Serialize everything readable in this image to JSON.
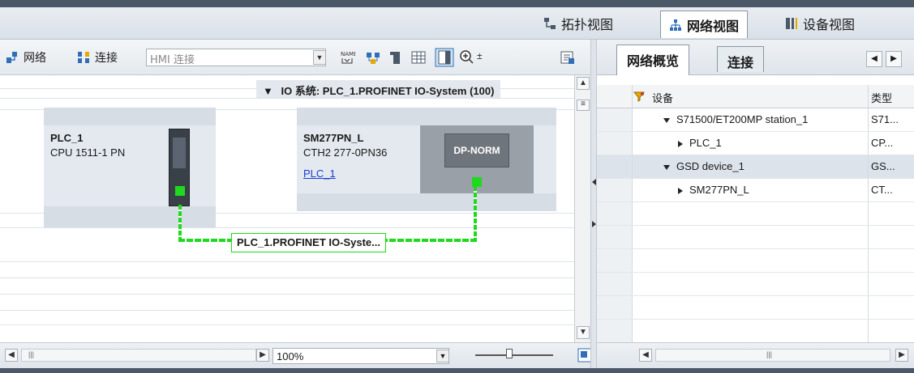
{
  "view_tabs": [
    {
      "label": "拓扑视图",
      "icon": "topology-icon"
    },
    {
      "label": "网络视图",
      "icon": "network-icon",
      "active": true
    },
    {
      "label": "设备视图",
      "icon": "device-icon"
    }
  ],
  "toolbar": {
    "network_label": "网络",
    "connections_label": "连接",
    "connection_type_value": "HMI 连接",
    "icons": [
      "name-icon",
      "network-tool-icon",
      "module-icon",
      "table-icon",
      "panel-icon",
      "zoom-in-icon",
      "export-icon"
    ]
  },
  "canvas": {
    "io_system_label": "IO 系统: PLC_1.PROFINET IO-System (100)",
    "network_line_label": "PLC_1.PROFINET IO-Syste...",
    "devices": [
      {
        "name": "PLC_1",
        "type": "CPU 1511-1 PN"
      },
      {
        "name": "SM277PN_L",
        "type": "CTH2 277-0PN36",
        "link": "PLC_1",
        "module_label": "DP-NORM"
      }
    ]
  },
  "statusbar": {
    "zoom_value": "100%"
  },
  "overview": {
    "tabs": [
      "网络概览",
      "连接"
    ],
    "columns": {
      "device": "设备",
      "type": "类型"
    },
    "rows": [
      {
        "device": "S71500/ET200MP station_1",
        "type": "S71...",
        "expanded": true,
        "indent": 0
      },
      {
        "device": "PLC_1",
        "type": "CP...",
        "expanded": false,
        "indent": 1
      },
      {
        "device": "GSD device_1",
        "type": "GS...",
        "expanded": true,
        "indent": 0
      },
      {
        "device": "SM277PN_L",
        "type": "CT...",
        "expanded": false,
        "indent": 1
      }
    ]
  },
  "colors": {
    "accent_green": "#1fd91f",
    "link_blue": "#1a3fd6",
    "frame_dark": "#4a5868"
  }
}
